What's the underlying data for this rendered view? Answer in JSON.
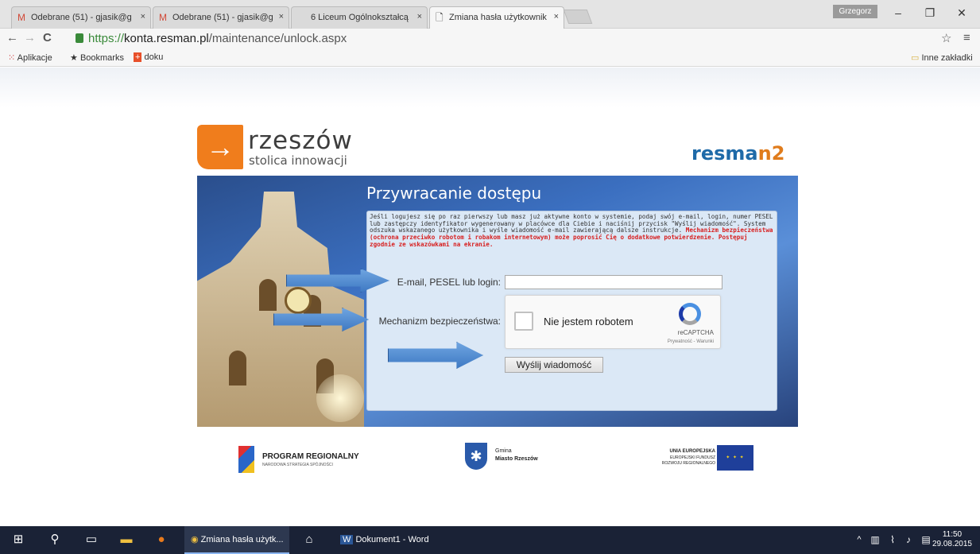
{
  "browser": {
    "tabs": [
      {
        "label": "Odebrane (51) - gjasik@g",
        "icon": "gmail-icon",
        "active": false
      },
      {
        "label": "Odebrane (51) - gjasik@g",
        "icon": "gmail-icon",
        "active": false
      },
      {
        "label": "6 Liceum Ogólnokształcą",
        "icon": "page-icon",
        "active": false
      },
      {
        "label": "Zmiana hasła użytkownik",
        "icon": "page-icon",
        "active": true
      }
    ],
    "tab_close": "×",
    "user_name": "Grzegorz",
    "url_scheme": "https://",
    "url_host": "konta.resman.pl",
    "url_path": "/maintenance/unlock.aspx",
    "bookmarks": [
      "Aplikacje",
      "Bookmarks",
      "doku"
    ],
    "other_bookmarks": "Inne zakładki"
  },
  "page": {
    "city_logo_word": "rzeszów",
    "city_logo_sub": "stolica innowacji",
    "resman_logo_a": "resma",
    "resman_logo_b": "n2",
    "title": "Przywracanie dostępu",
    "info_text": "Jeśli logujesz się po raz pierwszy lub masz już aktywne konto w systemie, podaj swój e-mail, login, numer PESEL lub zastępczy identyfikator wygenerowany w placówce dla Ciebie i naciśnij przycisk \"Wyślij wiadomość\". System odszuka wskazanego użytkownika i wyśle wiadomość e-mail zawierającą dalsze instrukcje.",
    "warning_text": "Mechanizm bezpieczeństwa (ochrona przeciwko robotom i robakom internetowym) może poprosić Cię o dodatkowe potwierdzenie. Postępuj zgodnie ze wskazówkami na ekranie.",
    "login_label": "E-mail, PESEL lub login:",
    "login_value": "",
    "security_label": "Mechanizm bezpieczeństwa:",
    "captcha_label": "Nie jestem robotem",
    "captcha_brand": "reCAPTCHA",
    "captcha_terms": "Prywatność - Warunki",
    "send_button": "Wyślij wiadomość"
  },
  "sponsors": {
    "program_title": "PROGRAM REGIONALNY",
    "program_sub": "NARODOWA STRATEGIA SPÓJNOŚCI",
    "gmina_line1": "Gmina",
    "gmina_line2": "Miasto Rzeszów",
    "eu_line1": "UNIA EUROPEJSKA",
    "eu_line2": "EUROPEJSKI FUNDUSZ",
    "eu_line3": "ROZWOJU REGIONALNEGO"
  },
  "taskbar": {
    "chrome_window": "Zmiana hasła użytk...",
    "word_window": "Dokument1 - Word",
    "time": "11:50",
    "date": "29.08.2015"
  },
  "colors": {
    "city_orange": "#f07d1c",
    "resman_blue": "#1e6aa8",
    "warning_red": "#d81f1f",
    "panel_bg": "#dbe8f6"
  }
}
